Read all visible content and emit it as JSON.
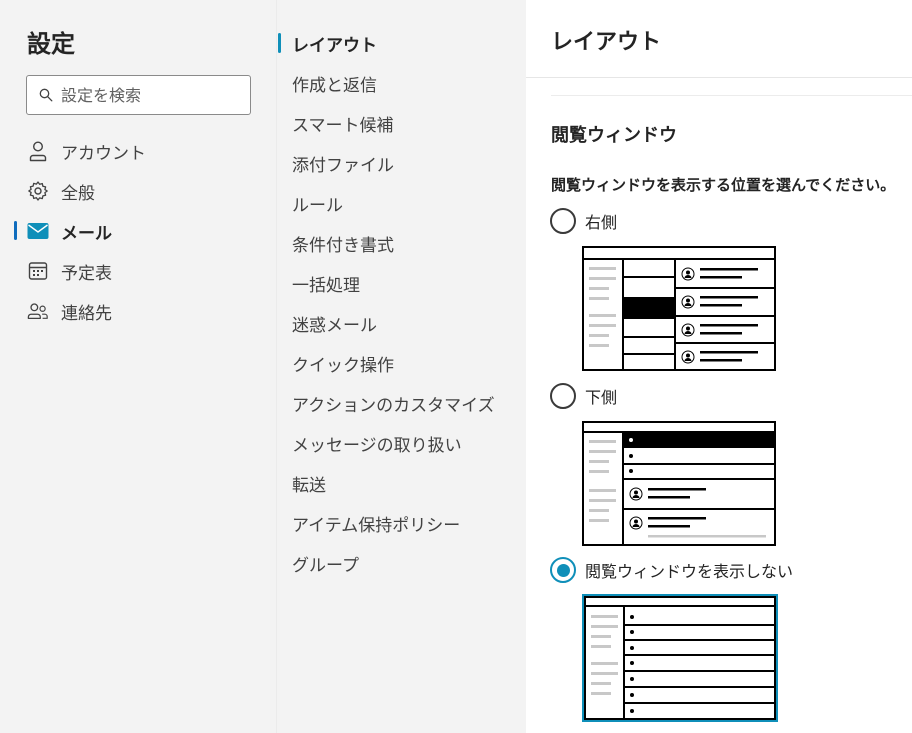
{
  "sidebar": {
    "title": "設定",
    "search_placeholder": "設定を検索",
    "items": [
      {
        "label": "アカウント",
        "icon": "person-icon"
      },
      {
        "label": "全般",
        "icon": "gear-icon"
      },
      {
        "label": "メール",
        "icon": "mail-icon",
        "active": true
      },
      {
        "label": "予定表",
        "icon": "calendar-icon"
      },
      {
        "label": "連絡先",
        "icon": "people-icon"
      }
    ]
  },
  "mail_nav": {
    "items": [
      {
        "label": "レイアウト",
        "active": true
      },
      {
        "label": "作成と返信"
      },
      {
        "label": "スマート候補"
      },
      {
        "label": "添付ファイル"
      },
      {
        "label": "ルール"
      },
      {
        "label": "条件付き書式"
      },
      {
        "label": "一括処理"
      },
      {
        "label": "迷惑メール"
      },
      {
        "label": "クイック操作"
      },
      {
        "label": "アクションのカスタマイズ"
      },
      {
        "label": "メッセージの取り扱い"
      },
      {
        "label": "転送"
      },
      {
        "label": "アイテム保持ポリシー"
      },
      {
        "label": "グループ"
      }
    ]
  },
  "main": {
    "title": "レイアウト",
    "section_title": "閲覧ウィンドウ",
    "section_desc": "閲覧ウィンドウを表示する位置を選んでください。",
    "options": [
      {
        "label": "右側",
        "checked": false
      },
      {
        "label": "下側",
        "checked": false
      },
      {
        "label": "閲覧ウィンドウを表示しない",
        "checked": true
      }
    ]
  },
  "colors": {
    "accent": "#0f8fb9",
    "mail_icon": "#0f8fb9",
    "panel_bg": "#f3f3f3",
    "content_bg": "#ffffff"
  }
}
